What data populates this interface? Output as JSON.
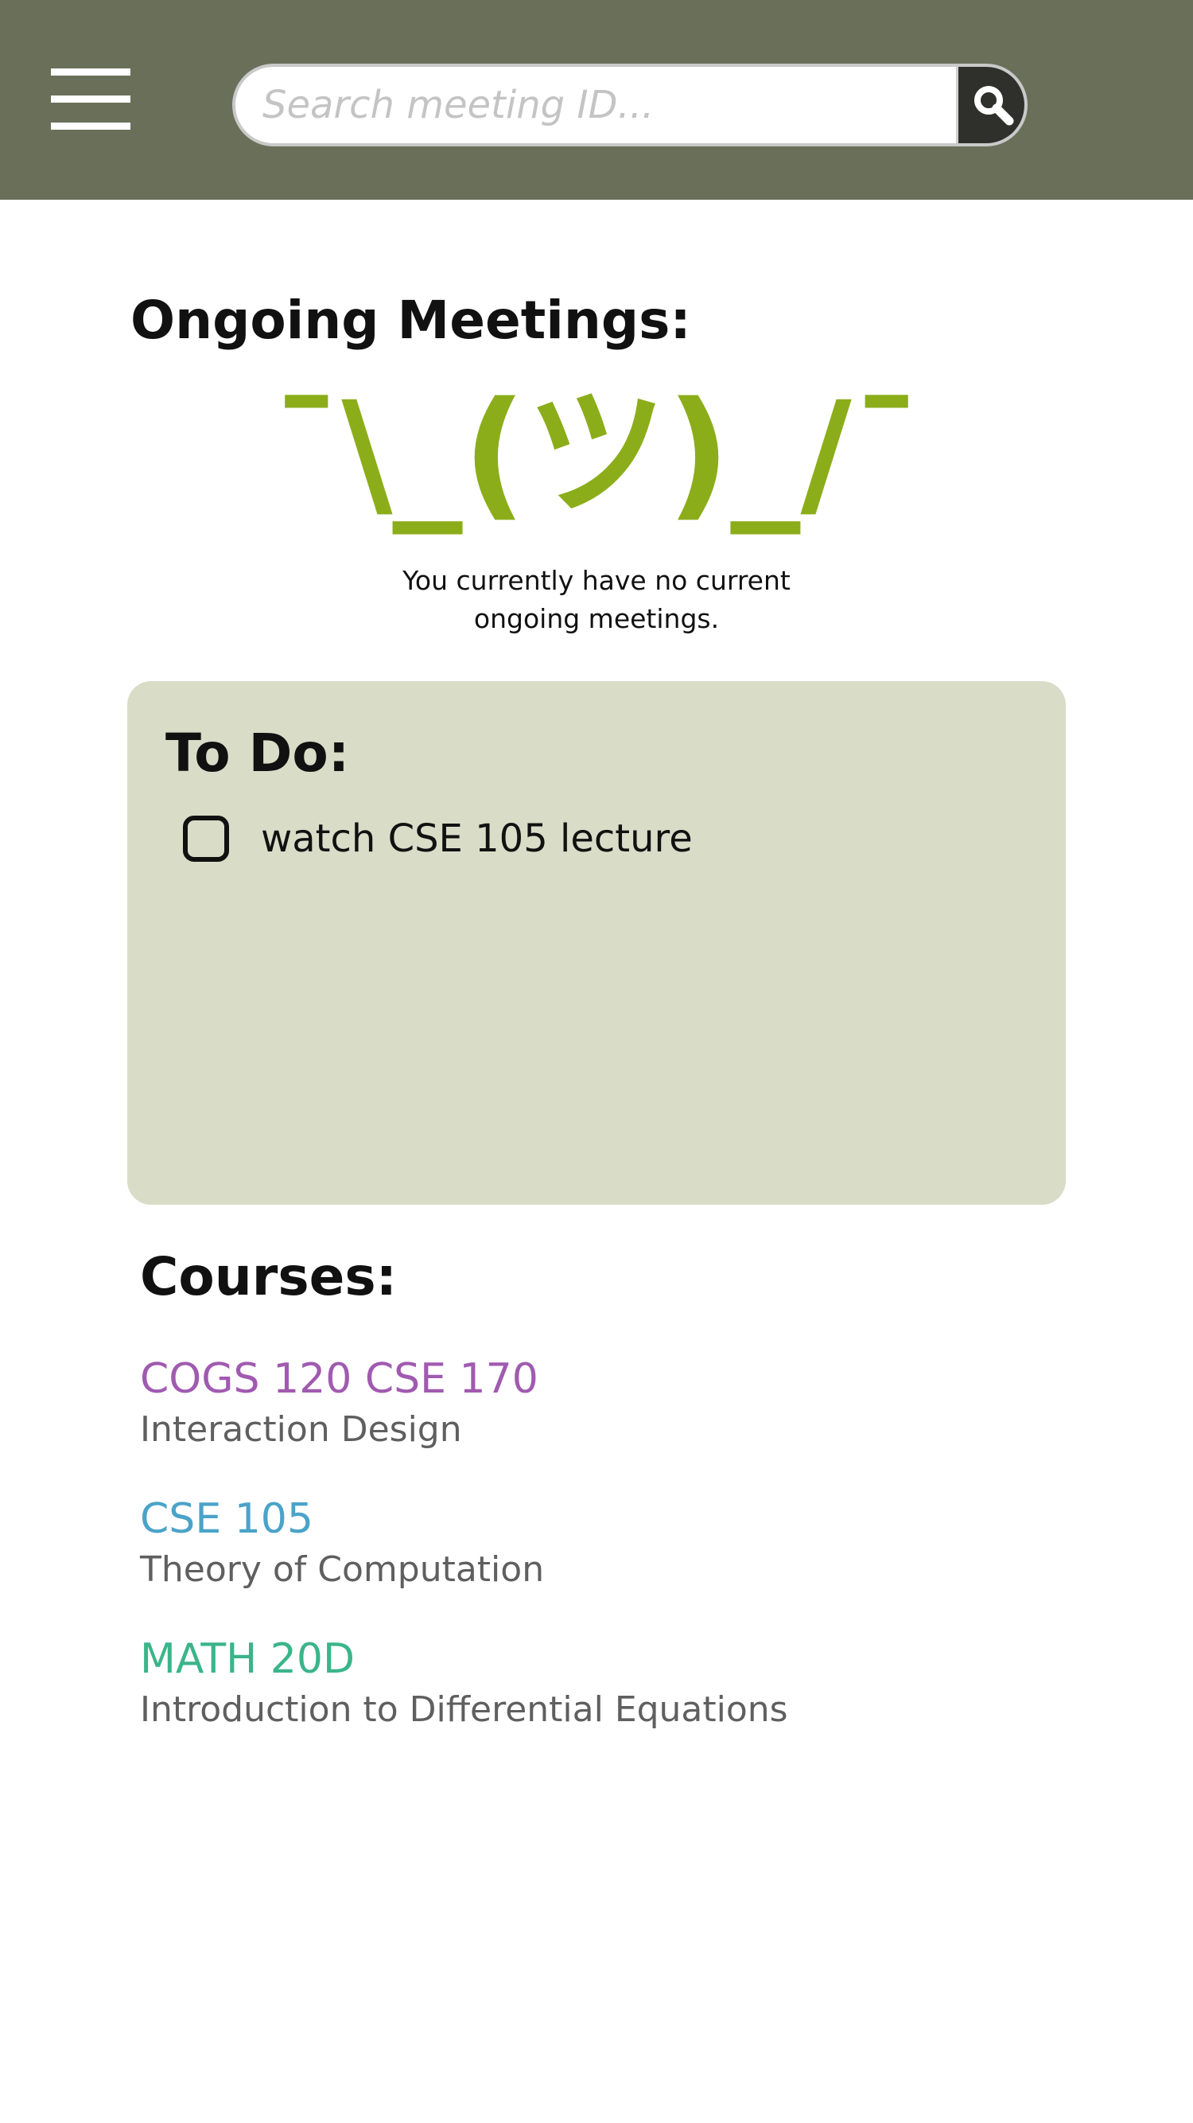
{
  "header": {
    "menu_icon": "hamburger-menu-icon",
    "search": {
      "placeholder": "Search meeting ID...",
      "value": "",
      "button_icon": "magnifier-icon"
    },
    "background_color": "#6a6f5a"
  },
  "ongoing": {
    "title": "Ongoing Meetings:",
    "shrug": "¯\\_(ツ)_/¯",
    "shrug_color": "#8cad1a",
    "empty_message_line1": "You currently have no current",
    "empty_message_line2": "ongoing meetings."
  },
  "todo": {
    "title": "To Do:",
    "background_color": "#d9dcc7",
    "items": [
      {
        "label": "watch CSE 105 lecture",
        "checked": false
      }
    ]
  },
  "courses": {
    "title": "Courses:",
    "items": [
      {
        "code": "COGS 120 CSE 170",
        "name": "Interaction Design",
        "color": "#a05ab0"
      },
      {
        "code": "CSE 105",
        "name": "Theory of Computation",
        "color": "#4aa3c8"
      },
      {
        "code": "MATH 20D",
        "name": "Introduction to Differential Equations",
        "color": "#3ab58a"
      }
    ]
  }
}
